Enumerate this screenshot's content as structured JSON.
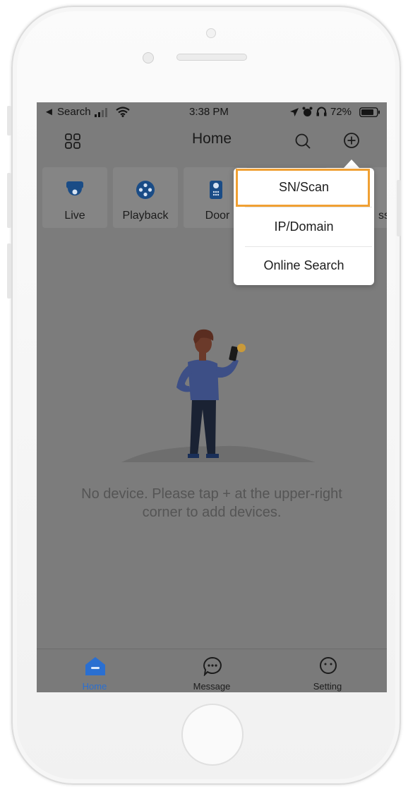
{
  "status_bar": {
    "back_app": "◄ Search",
    "time": "3:38 PM",
    "battery": "72%"
  },
  "header": {
    "title": "Home"
  },
  "toolbar": {
    "items": [
      {
        "label": "Live"
      },
      {
        "label": "Playback"
      },
      {
        "label": "Door"
      },
      {
        "label": "ss"
      }
    ]
  },
  "empty_state": {
    "message": "No device. Please tap + at the upper-right corner to add devices."
  },
  "add_menu": {
    "items": [
      "SN/Scan",
      "IP/Domain",
      "Online Search"
    ],
    "highlighted": "SN/Scan"
  },
  "tab_bar": {
    "tabs": [
      {
        "label": "Home",
        "active": true
      },
      {
        "label": "Message",
        "active": false
      },
      {
        "label": "Setting",
        "active": false
      }
    ]
  },
  "colors": {
    "accent": "#2a6fd1",
    "highlight_border": "#f0a033",
    "overlay_bg": "#7c7c7c"
  }
}
